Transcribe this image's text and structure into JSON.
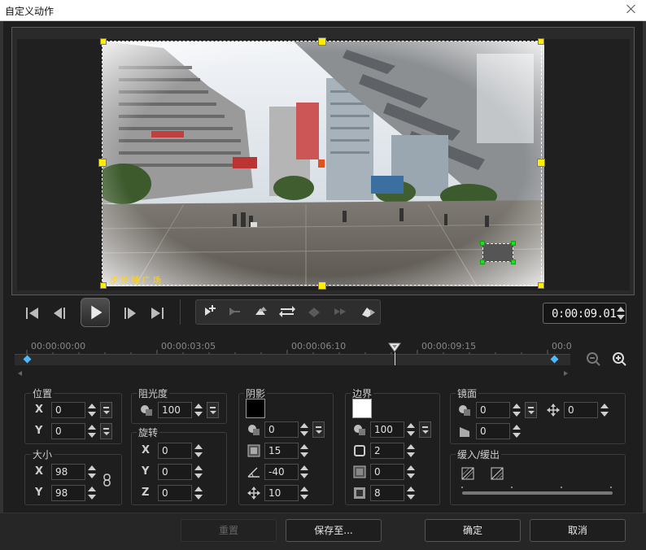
{
  "window": {
    "title": "自定义动作"
  },
  "preview": {
    "watermark": "步 步 铺 广 场"
  },
  "timecode": "0:00:09.01",
  "timeline": {
    "marks": [
      "00:00:00:00",
      "00:00:03:05",
      "00:00:06:10",
      "00:00:09:15",
      "00:0"
    ]
  },
  "position": {
    "title": "位置",
    "x_label": "X",
    "y_label": "Y",
    "x": "0",
    "y": "0"
  },
  "size": {
    "title": "大小",
    "x_label": "X",
    "y_label": "Y",
    "x": "98",
    "y": "98"
  },
  "opacity": {
    "title": "阻光度",
    "value": "100"
  },
  "rotation": {
    "title": "旋转",
    "x_label": "X",
    "y_label": "Y",
    "z_label": "Z",
    "x": "0",
    "y": "0",
    "z": "0"
  },
  "shadow": {
    "title": "阴影",
    "color": "#000000",
    "opacity": "0",
    "blur": "15",
    "angle": "-40",
    "distance": "10"
  },
  "border": {
    "title": "边界",
    "color": "#ffffff",
    "opacity": "100",
    "width": "2",
    "blur": "0",
    "edge": "8"
  },
  "mirror": {
    "title": "镜面",
    "opacity": "0",
    "offset": "0",
    "fade": "0"
  },
  "fade": {
    "title": "缓入/缓出"
  },
  "buttons": {
    "reset": "重置",
    "save_to": "保存至...",
    "ok": "确定",
    "cancel": "取消"
  }
}
